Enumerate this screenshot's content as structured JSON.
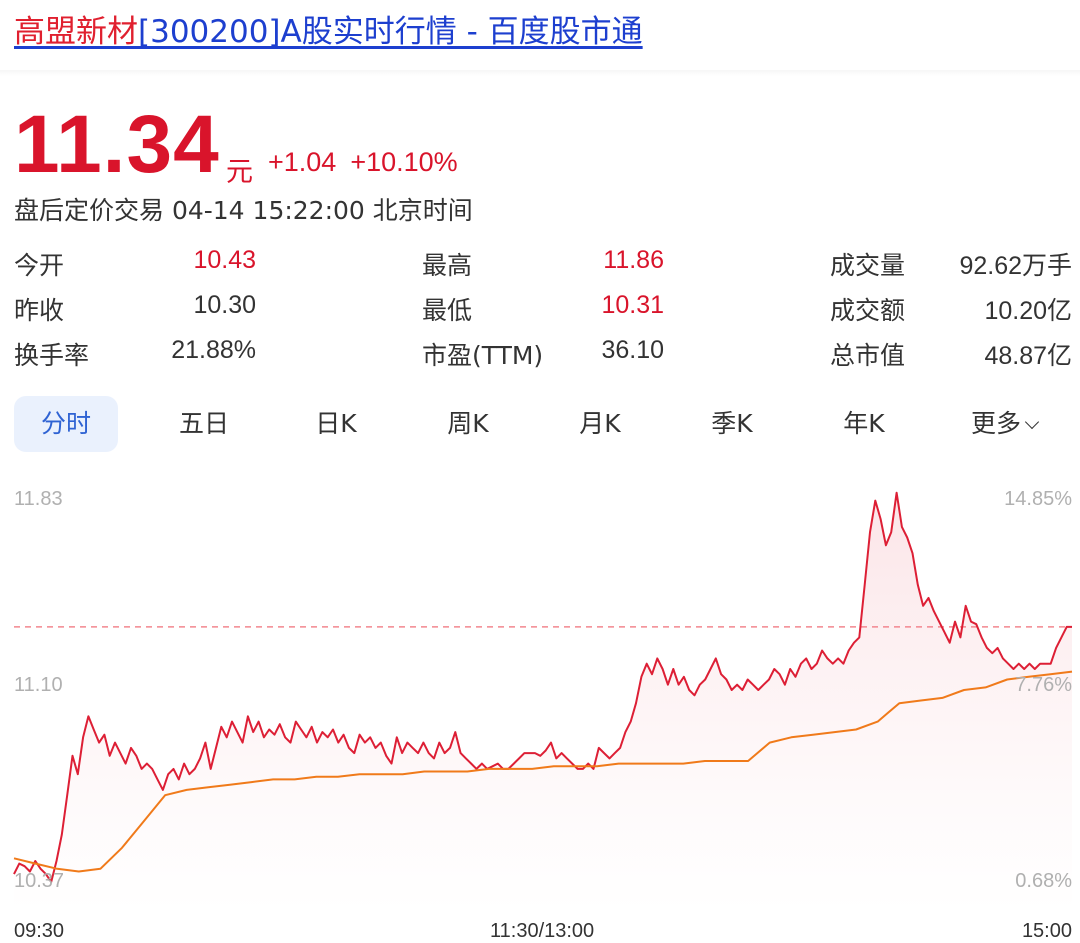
{
  "page": {
    "title_name": "高盟新材",
    "title_rest": "[300200]A股实时行情 - 百度股市通"
  },
  "quote": {
    "price": "11.34",
    "unit": "元",
    "change": "+1.04",
    "change_pct": "+10.10%",
    "status": "盘后定价交易 04-14 15:22:00 北京时间",
    "up_color": "#d9142b"
  },
  "stats": [
    {
      "label": "今开",
      "value": "10.43",
      "color": "red"
    },
    {
      "label": "最高",
      "value": "11.86",
      "color": "red"
    },
    {
      "label": "成交量",
      "value": "92.62万手",
      "color": "dark"
    },
    {
      "label": "昨收",
      "value": "10.30",
      "color": "dark"
    },
    {
      "label": "最低",
      "value": "10.31",
      "color": "red"
    },
    {
      "label": "成交额",
      "value": "10.20亿",
      "color": "dark"
    },
    {
      "label": "换手率",
      "value": "21.88%",
      "color": "dark"
    },
    {
      "label": "市盈(TTM)",
      "value": "36.10",
      "color": "dark"
    },
    {
      "label": "总市值",
      "value": "48.87亿",
      "color": "dark"
    }
  ],
  "tabs": [
    {
      "label": "分时",
      "active": true
    },
    {
      "label": "五日",
      "active": false
    },
    {
      "label": "日K",
      "active": false
    },
    {
      "label": "周K",
      "active": false
    },
    {
      "label": "月K",
      "active": false
    },
    {
      "label": "季K",
      "active": false
    },
    {
      "label": "年K",
      "active": false
    },
    {
      "label": "更多",
      "active": false,
      "dropdown": true
    }
  ],
  "chart_data": {
    "type": "line",
    "x_labels": [
      "09:30",
      "11:30/13:00",
      "15:00"
    ],
    "y_price_ticks": [
      "11.83",
      "11.10",
      "10.37"
    ],
    "y_pct_ticks": [
      "14.85%",
      "7.76%",
      "0.68%"
    ],
    "ylim": [
      10.37,
      11.83
    ],
    "prev_close_ref": 11.34,
    "colors": {
      "price": "#dd1f35",
      "avg": "#f07a1a",
      "ref": "#f2868f",
      "fill": "#fbe3e6"
    },
    "series": [
      {
        "name": "价格",
        "values": [
          10.4,
          10.44,
          10.43,
          10.41,
          10.45,
          10.42,
          10.4,
          10.37,
          10.45,
          10.55,
          10.7,
          10.85,
          10.78,
          10.92,
          11.0,
          10.95,
          10.9,
          10.93,
          10.85,
          10.9,
          10.86,
          10.82,
          10.88,
          10.85,
          10.8,
          10.82,
          10.8,
          10.76,
          10.72,
          10.78,
          10.8,
          10.76,
          10.82,
          10.78,
          10.8,
          10.84,
          10.9,
          10.8,
          10.88,
          10.96,
          10.92,
          10.98,
          10.94,
          10.9,
          11.0,
          10.94,
          10.98,
          10.92,
          10.95,
          10.93,
          10.97,
          10.92,
          10.9,
          10.98,
          10.95,
          10.92,
          10.96,
          10.9,
          10.94,
          10.92,
          10.95,
          10.9,
          10.93,
          10.88,
          10.86,
          10.93,
          10.9,
          10.92,
          10.88,
          10.9,
          10.85,
          10.82,
          10.92,
          10.86,
          10.9,
          10.88,
          10.86,
          10.9,
          10.86,
          10.84,
          10.9,
          10.86,
          10.88,
          10.94,
          10.86,
          10.84,
          10.82,
          10.8,
          10.82,
          10.8,
          10.81,
          10.82,
          10.8,
          10.8,
          10.82,
          10.84,
          10.86,
          10.86,
          10.86,
          10.85,
          10.87,
          10.9,
          10.84,
          10.86,
          10.84,
          10.82,
          10.8,
          10.8,
          10.82,
          10.8,
          10.88,
          10.86,
          10.84,
          10.86,
          10.88,
          10.94,
          10.98,
          11.05,
          11.15,
          11.2,
          11.16,
          11.22,
          11.18,
          11.12,
          11.18,
          11.12,
          11.15,
          11.1,
          11.08,
          11.12,
          11.14,
          11.18,
          11.22,
          11.16,
          11.14,
          11.1,
          11.12,
          11.1,
          11.14,
          11.12,
          11.1,
          11.12,
          11.14,
          11.18,
          11.16,
          11.12,
          11.18,
          11.15,
          11.2,
          11.22,
          11.18,
          11.2,
          11.25,
          11.22,
          11.2,
          11.22,
          11.2,
          11.25,
          11.28,
          11.3,
          11.5,
          11.7,
          11.82,
          11.75,
          11.65,
          11.7,
          11.85,
          11.72,
          11.68,
          11.62,
          11.5,
          11.42,
          11.45,
          11.4,
          11.36,
          11.32,
          11.28,
          11.36,
          11.3,
          11.42,
          11.36,
          11.35,
          11.3,
          11.26,
          11.24,
          11.26,
          11.22,
          11.2,
          11.18,
          11.2,
          11.18,
          11.2,
          11.18,
          11.2,
          11.2,
          11.2,
          11.26,
          11.3,
          11.34,
          11.34
        ]
      },
      {
        "name": "均价",
        "values": [
          10.46,
          10.44,
          10.42,
          10.41,
          10.42,
          10.5,
          10.6,
          10.7,
          10.72,
          10.73,
          10.74,
          10.75,
          10.76,
          10.76,
          10.77,
          10.77,
          10.78,
          10.78,
          10.78,
          10.79,
          10.79,
          10.79,
          10.8,
          10.8,
          10.8,
          10.81,
          10.81,
          10.81,
          10.82,
          10.82,
          10.82,
          10.82,
          10.83,
          10.83,
          10.83,
          10.9,
          10.92,
          10.93,
          10.94,
          10.95,
          10.98,
          11.05,
          11.06,
          11.07,
          11.1,
          11.11,
          11.14,
          11.15,
          11.16,
          11.17
        ]
      }
    ]
  }
}
